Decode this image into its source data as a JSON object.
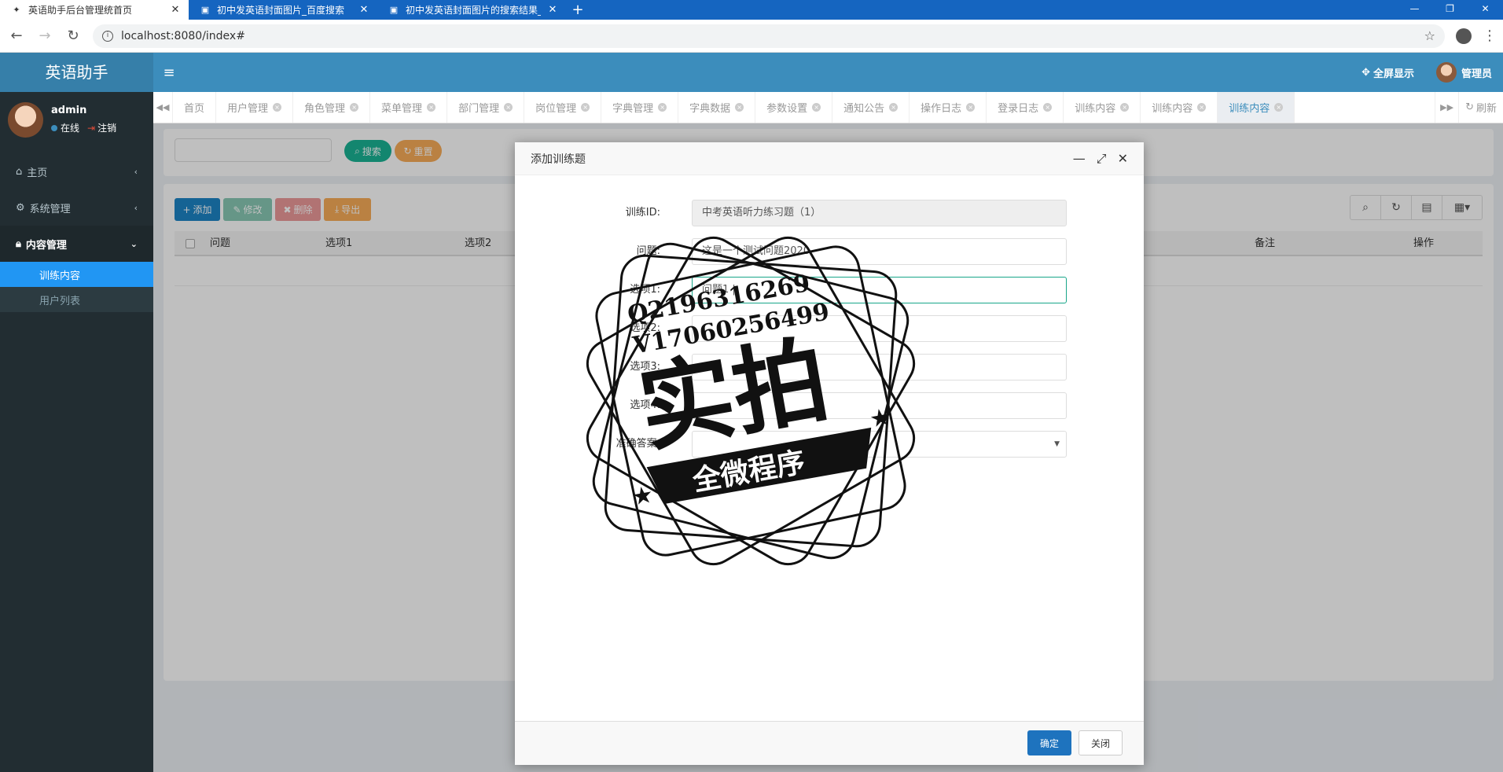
{
  "browser": {
    "tabs": [
      {
        "title": "英语助手后台管理统首页",
        "active": true
      },
      {
        "title": "初中发英语封面图片_百度搜索",
        "active": false
      },
      {
        "title": "初中发英语封面图片的搜索结果_",
        "active": false
      }
    ],
    "new_tab": "+",
    "url": "localhost:8080/index#"
  },
  "app": {
    "logo": "英语助手",
    "fullscreen_label": "全屏显示",
    "user_label": "管理员"
  },
  "sidebar": {
    "username": "admin",
    "online": "在线",
    "logout": "注销",
    "items": [
      {
        "label": "主页",
        "icon": "home-icon"
      },
      {
        "label": "系统管理",
        "icon": "gear-icon"
      },
      {
        "label": "内容管理",
        "icon": "lock-icon"
      }
    ],
    "subitems": [
      {
        "label": "训练内容",
        "active": true
      },
      {
        "label": "用户列表",
        "active": false
      }
    ]
  },
  "content_tabs": [
    {
      "label": "首页",
      "closable": false
    },
    {
      "label": "用户管理",
      "closable": true
    },
    {
      "label": "角色管理",
      "closable": true
    },
    {
      "label": "菜单管理",
      "closable": true
    },
    {
      "label": "部门管理",
      "closable": true
    },
    {
      "label": "岗位管理",
      "closable": true
    },
    {
      "label": "字典管理",
      "closable": true
    },
    {
      "label": "字典数据",
      "closable": true
    },
    {
      "label": "参数设置",
      "closable": true
    },
    {
      "label": "通知公告",
      "closable": true
    },
    {
      "label": "操作日志",
      "closable": true
    },
    {
      "label": "登录日志",
      "closable": true
    },
    {
      "label": "训练内容",
      "closable": true
    },
    {
      "label": "训练内容",
      "closable": true
    },
    {
      "label": "训练内容",
      "closable": true,
      "active": true
    }
  ],
  "refresh_label": "刷新",
  "search": {
    "search_btn": "搜索",
    "reset_btn": "重置"
  },
  "toolbar": {
    "add": "添加",
    "edit": "修改",
    "delete": "删除",
    "export": "导出"
  },
  "table": {
    "columns": [
      "问题",
      "选项1",
      "选项2",
      "备注",
      "操作"
    ]
  },
  "modal": {
    "title": "添加训练题",
    "fields": [
      {
        "label": "训练ID:",
        "value": "中考英语听力练习题（1）",
        "readonly": true
      },
      {
        "label": "问题:",
        "value": "这是一个测试问题2020"
      },
      {
        "label": "选项1:",
        "value": "问题1 |",
        "focus": true
      },
      {
        "label": "选项2:",
        "value": ""
      },
      {
        "label": "选项3:",
        "value": ""
      },
      {
        "label": "选项4:",
        "value": ""
      },
      {
        "label": "准确答案:",
        "value": "",
        "select": true
      }
    ],
    "confirm": "确定",
    "close": "关闭"
  },
  "watermark": {
    "line1": "Q2196316269",
    "line2": "V17060256499",
    "main": "实拍",
    "ribbon": "全微程序"
  },
  "colors": {
    "header": "#3c8dbc",
    "sidebar": "#222d32",
    "active_menu": "#2196f3",
    "add_btn": "#1c84c6",
    "edit_btn": "#88c9b4",
    "delete_btn": "#ed9a9a",
    "export_btn": "#f8ac59",
    "search_btn": "#1ab394",
    "reset_btn": "#f8ac59"
  }
}
